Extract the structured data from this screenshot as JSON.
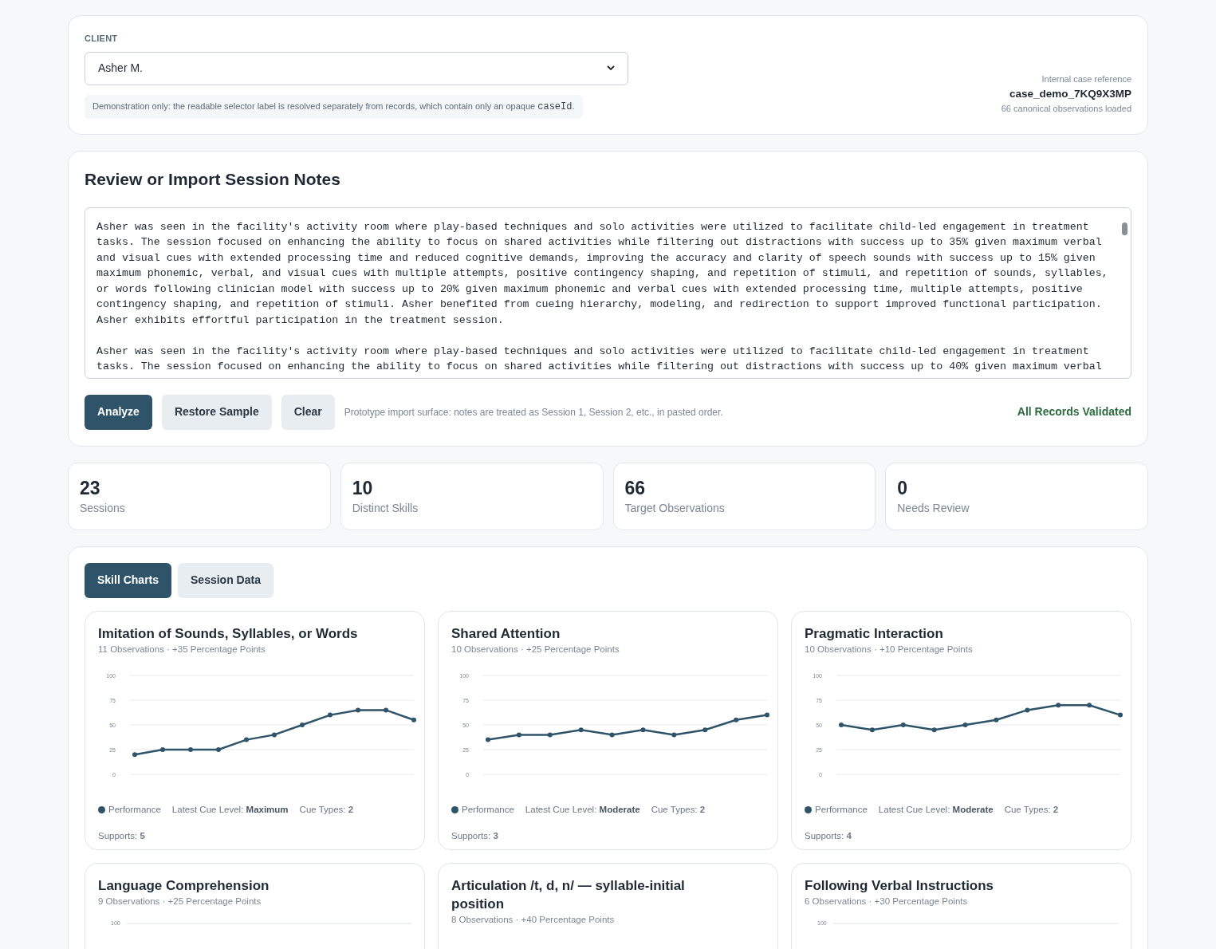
{
  "client": {
    "label": "CLIENT",
    "selected_value": "Asher M.",
    "note": "Demonstration only: the readable selector label is resolved separately from records, which contain only an opaque ",
    "note_code": "caseId",
    "note_end": ".",
    "reference_label": "Internal case reference",
    "reference": "case_demo_7KQ9X3MP",
    "observations_loaded": "66 canonical observations loaded"
  },
  "notes": {
    "title": "Review or Import Session Notes",
    "paragraphs": [
      "Asher was seen in the facility's activity room where play-based techniques and solo activities were utilized to facilitate child-led engagement in treatment tasks. The session focused on enhancing the ability to focus on shared activities while filtering out distractions with success up to 35% given maximum verbal and visual cues with extended processing time and reduced cognitive demands, improving the accuracy and clarity of speech sounds with success up to 15% given maximum phonemic, verbal, and visual cues with multiple attempts, positive contingency shaping, and repetition of stimuli, and repetition of sounds, syllables, or words following clinician model with success up to 20% given maximum phonemic and verbal cues with extended processing time, multiple attempts, positive contingency shaping, and repetition of stimuli. Asher benefited from cueing hierarchy, modeling, and redirection to support improved functional participation. Asher exhibits effortful participation in the treatment session.",
      "Asher was seen in the facility's activity room where play-based techniques and solo activities were utilized to facilitate child-led engagement in treatment tasks. The session focused on enhancing the ability to focus on shared activities while filtering out distractions with success up to 40% given maximum verbal"
    ],
    "buttons": [
      {
        "label": "Analyze",
        "kind": "primary"
      },
      {
        "label": "Restore Sample",
        "kind": "secondary"
      },
      {
        "label": "Clear",
        "kind": "secondary"
      }
    ],
    "hint": "Prototype import surface: notes are treated as Session 1, Session 2, etc., in pasted order.",
    "status": "All Records Validated"
  },
  "stats": [
    {
      "value": "23",
      "label": "Sessions"
    },
    {
      "value": "10",
      "label": "Distinct Skills"
    },
    {
      "value": "66",
      "label": "Target Observations"
    },
    {
      "value": "0",
      "label": "Needs Review"
    }
  ],
  "tabs": [
    {
      "label": "Skill Charts",
      "selected": true
    },
    {
      "label": "Session Data",
      "selected": false
    }
  ],
  "skills": [
    {
      "kind": "full",
      "title": "Imitation of Sounds, Syllables, or Words",
      "subtitle": "11 Observations · +35 Percentage Points",
      "cue_level": "Latest Cue Level: **Maximum**",
      "cue_types": "Cue Types: **2**",
      "supports": "Supports: **5**",
      "chart_data": {
        "type": "line",
        "grid": true,
        "ylim": [
          0,
          100
        ],
        "yticks": [
          0,
          25,
          50,
          75,
          100
        ],
        "series": [
          {
            "name": "Performance",
            "color": "#2f5469",
            "marker": "circle",
            "values": [
              20,
              25,
              25,
              25,
              35,
              40,
              50,
              60,
              65,
              65,
              55
            ]
          }
        ]
      }
    },
    {
      "kind": "full",
      "title": "Shared Attention",
      "subtitle": "10 Observations · +25 Percentage Points",
      "cue_level": "Latest Cue Level: **Moderate**",
      "cue_types": "Cue Types: **2**",
      "supports": "Supports: **3**",
      "chart_data": {
        "type": "line",
        "grid": true,
        "ylim": [
          0,
          100
        ],
        "yticks": [
          0,
          25,
          50,
          75,
          100
        ],
        "series": [
          {
            "name": "Performance",
            "color": "#2f5469",
            "marker": "circle",
            "values": [
              35,
              40,
              40,
              45,
              40,
              45,
              40,
              45,
              55,
              60
            ]
          }
        ]
      }
    },
    {
      "kind": "full",
      "title": "Pragmatic Interaction",
      "subtitle": "10 Observations · +10 Percentage Points",
      "cue_level": "Latest Cue Level: **Moderate**",
      "cue_types": "Cue Types: **2**",
      "supports": "Supports: **4**",
      "chart_data": {
        "type": "line",
        "grid": true,
        "ylim": [
          0,
          100
        ],
        "yticks": [
          0,
          25,
          50,
          75,
          100
        ],
        "series": [
          {
            "name": "Performance",
            "color": "#2f5469",
            "marker": "circle",
            "values": [
              50,
              45,
              50,
              45,
              50,
              55,
              65,
              70,
              70,
              60
            ]
          }
        ]
      }
    },
    {
      "kind": "partial",
      "title": "Language Comprehension",
      "subtitle": "9 Observations · +25 Percentage Points",
      "top_tick": "100"
    },
    {
      "kind": "partial",
      "title": "Articulation /t, d, n/ — syllable-initial position",
      "subtitle": "8 Observations · +40 Percentage Points"
    },
    {
      "kind": "partial",
      "title": "Following Verbal Instructions",
      "subtitle": "6 Observations · +30 Percentage Points",
      "top_tick": "100"
    }
  ]
}
